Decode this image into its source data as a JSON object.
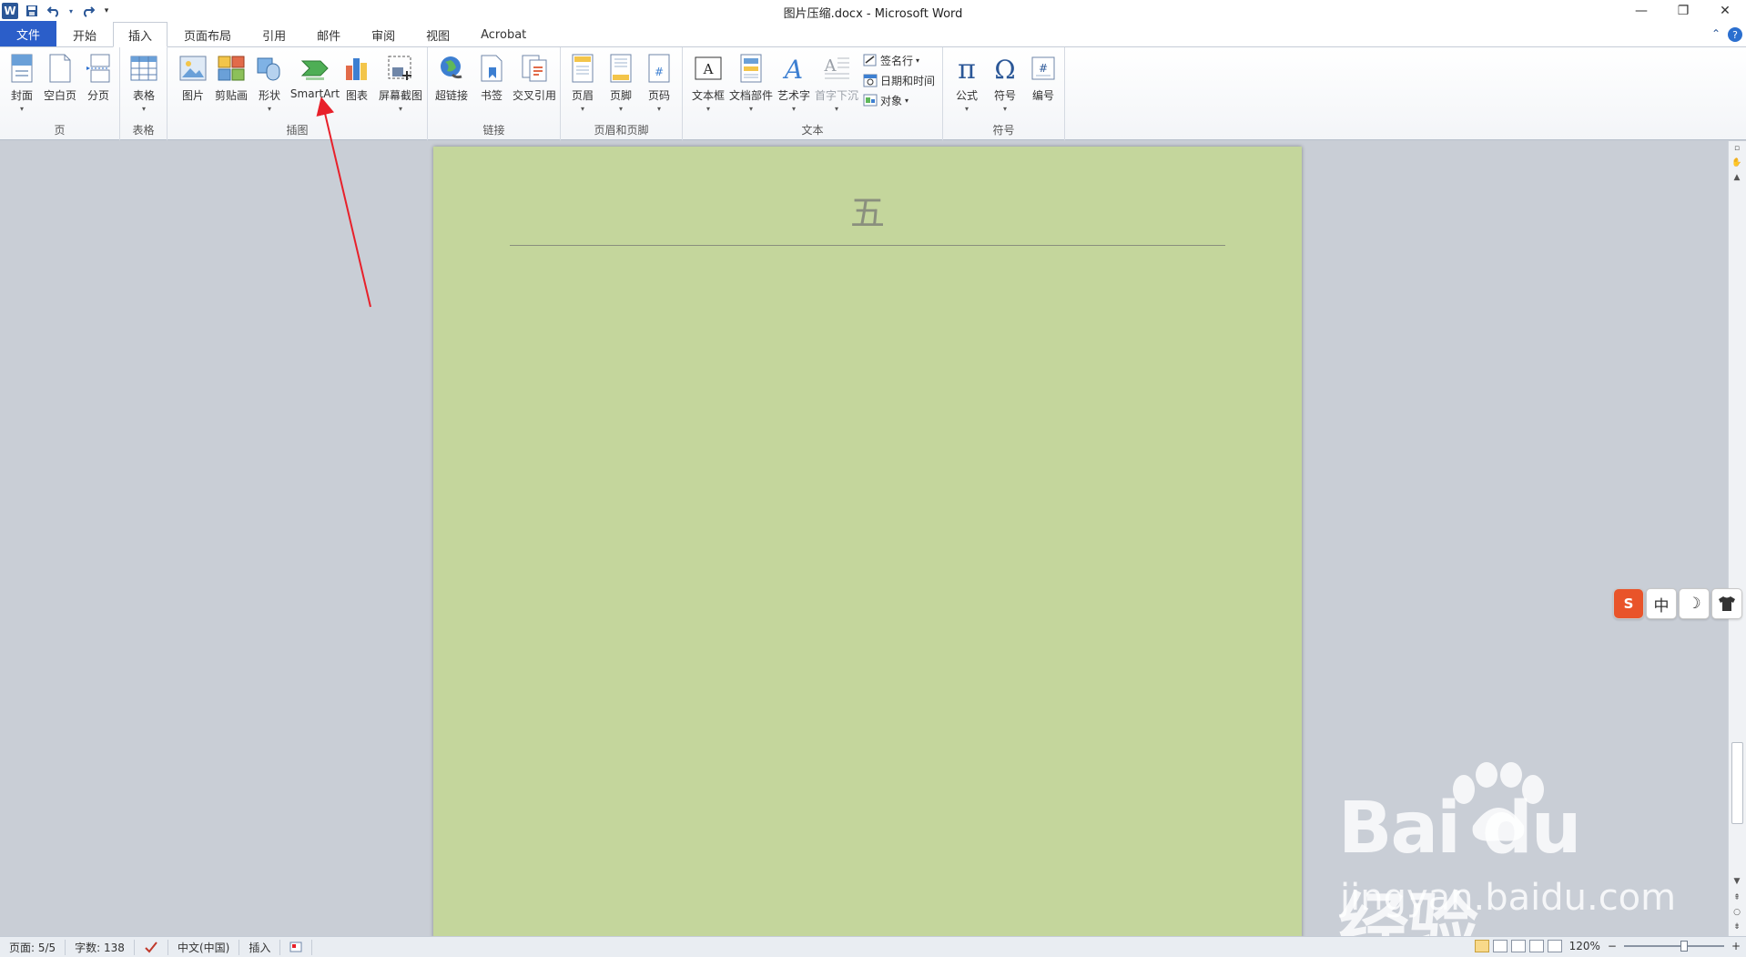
{
  "window": {
    "title": "图片压缩.docx - Microsoft Word",
    "app_logo": "W",
    "controls": {
      "minimize": "—",
      "restore": "❐",
      "close": "✕"
    }
  },
  "qat": {
    "save_icon": "save-icon",
    "undo_icon": "undo-icon",
    "redo_icon": "redo-icon"
  },
  "tabs": [
    {
      "label": "文件"
    },
    {
      "label": "开始"
    },
    {
      "label": "插入"
    },
    {
      "label": "页面布局"
    },
    {
      "label": "引用"
    },
    {
      "label": "邮件"
    },
    {
      "label": "审阅"
    },
    {
      "label": "视图"
    },
    {
      "label": "Acrobat"
    }
  ],
  "ribbon": {
    "groups": {
      "pages": {
        "label": "页",
        "buttons": [
          "封面",
          "空白页",
          "分页"
        ]
      },
      "tables": {
        "label": "表格",
        "buttons": [
          "表格"
        ]
      },
      "illustrations": {
        "label": "插图",
        "buttons": [
          "图片",
          "剪贴画",
          "形状",
          "SmartArt",
          "图表",
          "屏幕截图"
        ]
      },
      "links": {
        "label": "链接",
        "buttons": [
          "超链接",
          "书签",
          "交叉引用"
        ]
      },
      "header_footer": {
        "label": "页眉和页脚",
        "buttons": [
          "页眉",
          "页脚",
          "页码"
        ]
      },
      "text": {
        "label": "文本",
        "buttons": [
          "文本框",
          "文档部件",
          "艺术字",
          "首字下沉"
        ],
        "small": [
          "签名行",
          "日期和时间",
          "对象"
        ]
      },
      "symbols": {
        "label": "符号",
        "buttons": [
          "公式",
          "符号",
          "编号"
        ]
      }
    }
  },
  "document": {
    "heading": "五"
  },
  "ime": {
    "logo": "S",
    "mode": "中",
    "moon": "☽",
    "skin": "👕"
  },
  "status": {
    "page": "页面: 5/5",
    "words": "字数: 138",
    "language": "中文(中国)",
    "mode": "插入",
    "zoom": "120%",
    "zoom_minus": "−",
    "zoom_plus": "+"
  },
  "watermark": {
    "main": "Bai du 经验",
    "sub": "jingyan.baidu.com"
  },
  "colors": {
    "file_tab": "#2b5ec9",
    "page_bg": "#c4d69c",
    "arrow": "#e8202a"
  }
}
